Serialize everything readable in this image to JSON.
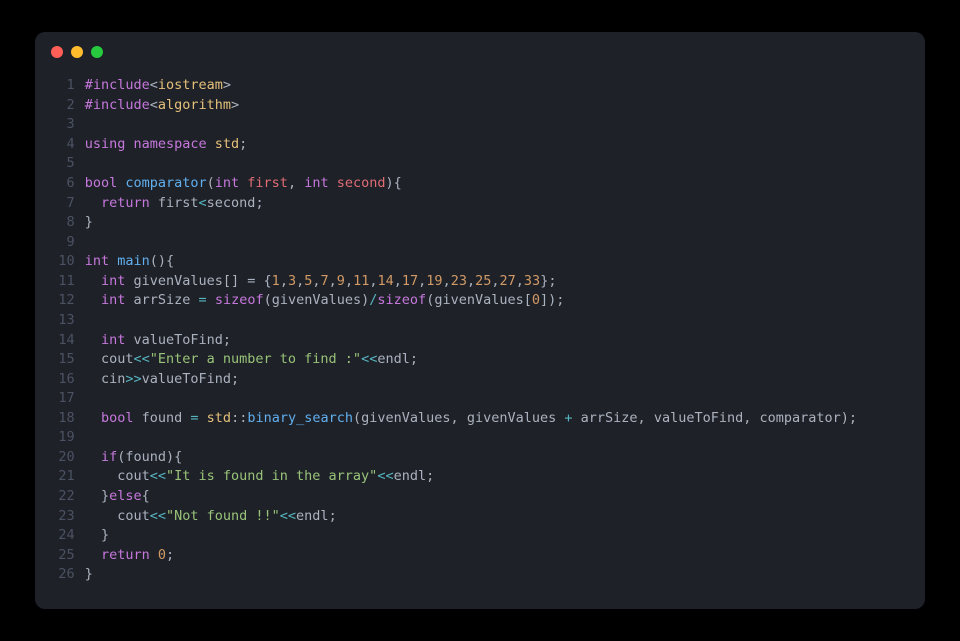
{
  "window": {
    "traffic_lights": {
      "close": "red",
      "minimize": "yellow",
      "zoom": "green"
    }
  },
  "code": {
    "lines": [
      {
        "n": 1,
        "tokens": [
          {
            "c": "kw",
            "t": "#include"
          },
          {
            "c": "punct",
            "t": "<"
          },
          {
            "c": "prop",
            "t": "iostream"
          },
          {
            "c": "punct",
            "t": ">"
          }
        ]
      },
      {
        "n": 2,
        "tokens": [
          {
            "c": "kw",
            "t": "#include"
          },
          {
            "c": "punct",
            "t": "<"
          },
          {
            "c": "prop",
            "t": "algorithm"
          },
          {
            "c": "punct",
            "t": ">"
          }
        ]
      },
      {
        "n": 3,
        "tokens": []
      },
      {
        "n": 4,
        "tokens": [
          {
            "c": "kw",
            "t": "using"
          },
          {
            "c": "plain",
            "t": " "
          },
          {
            "c": "kw",
            "t": "namespace"
          },
          {
            "c": "plain",
            "t": " "
          },
          {
            "c": "prop",
            "t": "std"
          },
          {
            "c": "punct",
            "t": ";"
          }
        ]
      },
      {
        "n": 5,
        "tokens": []
      },
      {
        "n": 6,
        "tokens": [
          {
            "c": "type",
            "t": "bool"
          },
          {
            "c": "plain",
            "t": " "
          },
          {
            "c": "fn",
            "t": "comparator"
          },
          {
            "c": "punct",
            "t": "("
          },
          {
            "c": "type",
            "t": "int"
          },
          {
            "c": "plain",
            "t": " "
          },
          {
            "c": "var",
            "t": "first"
          },
          {
            "c": "punct",
            "t": ", "
          },
          {
            "c": "type",
            "t": "int"
          },
          {
            "c": "plain",
            "t": " "
          },
          {
            "c": "var",
            "t": "second"
          },
          {
            "c": "punct",
            "t": "){"
          }
        ]
      },
      {
        "n": 7,
        "tokens": [
          {
            "c": "plain",
            "t": "  "
          },
          {
            "c": "kw",
            "t": "return"
          },
          {
            "c": "plain",
            "t": " "
          },
          {
            "c": "ident",
            "t": "first"
          },
          {
            "c": "op",
            "t": "<"
          },
          {
            "c": "ident",
            "t": "second"
          },
          {
            "c": "punct",
            "t": ";"
          }
        ]
      },
      {
        "n": 8,
        "tokens": [
          {
            "c": "punct",
            "t": "}"
          }
        ]
      },
      {
        "n": 9,
        "tokens": []
      },
      {
        "n": 10,
        "tokens": [
          {
            "c": "type",
            "t": "int"
          },
          {
            "c": "plain",
            "t": " "
          },
          {
            "c": "fn",
            "t": "main"
          },
          {
            "c": "punct",
            "t": "(){"
          }
        ]
      },
      {
        "n": 11,
        "tokens": [
          {
            "c": "plain",
            "t": "  "
          },
          {
            "c": "type",
            "t": "int"
          },
          {
            "c": "plain",
            "t": " "
          },
          {
            "c": "ident",
            "t": "givenValues"
          },
          {
            "c": "punct",
            "t": "[] = {"
          },
          {
            "c": "num",
            "t": "1"
          },
          {
            "c": "punct",
            "t": ","
          },
          {
            "c": "num",
            "t": "3"
          },
          {
            "c": "punct",
            "t": ","
          },
          {
            "c": "num",
            "t": "5"
          },
          {
            "c": "punct",
            "t": ","
          },
          {
            "c": "num",
            "t": "7"
          },
          {
            "c": "punct",
            "t": ","
          },
          {
            "c": "num",
            "t": "9"
          },
          {
            "c": "punct",
            "t": ","
          },
          {
            "c": "num",
            "t": "11"
          },
          {
            "c": "punct",
            "t": ","
          },
          {
            "c": "num",
            "t": "14"
          },
          {
            "c": "punct",
            "t": ","
          },
          {
            "c": "num",
            "t": "17"
          },
          {
            "c": "punct",
            "t": ","
          },
          {
            "c": "num",
            "t": "19"
          },
          {
            "c": "punct",
            "t": ","
          },
          {
            "c": "num",
            "t": "23"
          },
          {
            "c": "punct",
            "t": ","
          },
          {
            "c": "num",
            "t": "25"
          },
          {
            "c": "punct",
            "t": ","
          },
          {
            "c": "num",
            "t": "27"
          },
          {
            "c": "punct",
            "t": ","
          },
          {
            "c": "num",
            "t": "33"
          },
          {
            "c": "punct",
            "t": "};"
          }
        ]
      },
      {
        "n": 12,
        "tokens": [
          {
            "c": "plain",
            "t": "  "
          },
          {
            "c": "type",
            "t": "int"
          },
          {
            "c": "plain",
            "t": " "
          },
          {
            "c": "ident",
            "t": "arrSize"
          },
          {
            "c": "plain",
            "t": " "
          },
          {
            "c": "op",
            "t": "="
          },
          {
            "c": "plain",
            "t": " "
          },
          {
            "c": "kw",
            "t": "sizeof"
          },
          {
            "c": "punct",
            "t": "("
          },
          {
            "c": "ident",
            "t": "givenValues"
          },
          {
            "c": "punct",
            "t": ")"
          },
          {
            "c": "op",
            "t": "/"
          },
          {
            "c": "kw",
            "t": "sizeof"
          },
          {
            "c": "punct",
            "t": "("
          },
          {
            "c": "ident",
            "t": "givenValues"
          },
          {
            "c": "punct",
            "t": "["
          },
          {
            "c": "num",
            "t": "0"
          },
          {
            "c": "punct",
            "t": "]);"
          }
        ]
      },
      {
        "n": 13,
        "tokens": []
      },
      {
        "n": 14,
        "tokens": [
          {
            "c": "plain",
            "t": "  "
          },
          {
            "c": "type",
            "t": "int"
          },
          {
            "c": "plain",
            "t": " "
          },
          {
            "c": "ident",
            "t": "valueToFind"
          },
          {
            "c": "punct",
            "t": ";"
          }
        ]
      },
      {
        "n": 15,
        "tokens": [
          {
            "c": "plain",
            "t": "  "
          },
          {
            "c": "ident",
            "t": "cout"
          },
          {
            "c": "op",
            "t": "<<"
          },
          {
            "c": "str",
            "t": "\"Enter a number to find :\""
          },
          {
            "c": "op",
            "t": "<<"
          },
          {
            "c": "ident",
            "t": "endl"
          },
          {
            "c": "punct",
            "t": ";"
          }
        ]
      },
      {
        "n": 16,
        "tokens": [
          {
            "c": "plain",
            "t": "  "
          },
          {
            "c": "ident",
            "t": "cin"
          },
          {
            "c": "op",
            "t": ">>"
          },
          {
            "c": "ident",
            "t": "valueToFind"
          },
          {
            "c": "punct",
            "t": ";"
          }
        ]
      },
      {
        "n": 17,
        "tokens": []
      },
      {
        "n": 18,
        "tokens": [
          {
            "c": "plain",
            "t": "  "
          },
          {
            "c": "type",
            "t": "bool"
          },
          {
            "c": "plain",
            "t": " "
          },
          {
            "c": "ident",
            "t": "found"
          },
          {
            "c": "plain",
            "t": " "
          },
          {
            "c": "op",
            "t": "="
          },
          {
            "c": "plain",
            "t": " "
          },
          {
            "c": "prop",
            "t": "std"
          },
          {
            "c": "punct",
            "t": "::"
          },
          {
            "c": "fn",
            "t": "binary_search"
          },
          {
            "c": "punct",
            "t": "("
          },
          {
            "c": "ident",
            "t": "givenValues"
          },
          {
            "c": "punct",
            "t": ", "
          },
          {
            "c": "ident",
            "t": "givenValues"
          },
          {
            "c": "plain",
            "t": " "
          },
          {
            "c": "op",
            "t": "+"
          },
          {
            "c": "plain",
            "t": " "
          },
          {
            "c": "ident",
            "t": "arrSize"
          },
          {
            "c": "punct",
            "t": ", "
          },
          {
            "c": "ident",
            "t": "valueToFind"
          },
          {
            "c": "punct",
            "t": ", "
          },
          {
            "c": "ident",
            "t": "comparator"
          },
          {
            "c": "punct",
            "t": ");"
          }
        ]
      },
      {
        "n": 19,
        "tokens": []
      },
      {
        "n": 20,
        "tokens": [
          {
            "c": "plain",
            "t": "  "
          },
          {
            "c": "kw",
            "t": "if"
          },
          {
            "c": "punct",
            "t": "("
          },
          {
            "c": "ident",
            "t": "found"
          },
          {
            "c": "punct",
            "t": "){"
          }
        ]
      },
      {
        "n": 21,
        "tokens": [
          {
            "c": "plain",
            "t": "    "
          },
          {
            "c": "ident",
            "t": "cout"
          },
          {
            "c": "op",
            "t": "<<"
          },
          {
            "c": "str",
            "t": "\"It is found in the array\""
          },
          {
            "c": "op",
            "t": "<<"
          },
          {
            "c": "ident",
            "t": "endl"
          },
          {
            "c": "punct",
            "t": ";"
          }
        ]
      },
      {
        "n": 22,
        "tokens": [
          {
            "c": "plain",
            "t": "  "
          },
          {
            "c": "punct",
            "t": "}"
          },
          {
            "c": "kw",
            "t": "else"
          },
          {
            "c": "punct",
            "t": "{"
          }
        ]
      },
      {
        "n": 23,
        "tokens": [
          {
            "c": "plain",
            "t": "    "
          },
          {
            "c": "ident",
            "t": "cout"
          },
          {
            "c": "op",
            "t": "<<"
          },
          {
            "c": "str",
            "t": "\"Not found !!\""
          },
          {
            "c": "op",
            "t": "<<"
          },
          {
            "c": "ident",
            "t": "endl"
          },
          {
            "c": "punct",
            "t": ";"
          }
        ]
      },
      {
        "n": 24,
        "tokens": [
          {
            "c": "plain",
            "t": "  "
          },
          {
            "c": "punct",
            "t": "}"
          }
        ]
      },
      {
        "n": 25,
        "tokens": [
          {
            "c": "plain",
            "t": "  "
          },
          {
            "c": "kw",
            "t": "return"
          },
          {
            "c": "plain",
            "t": " "
          },
          {
            "c": "num",
            "t": "0"
          },
          {
            "c": "punct",
            "t": ";"
          }
        ]
      },
      {
        "n": 26,
        "tokens": [
          {
            "c": "punct",
            "t": "}"
          }
        ]
      }
    ]
  }
}
